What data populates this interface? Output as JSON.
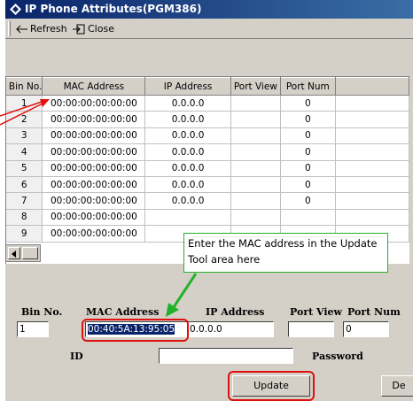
{
  "window": {
    "title": "IP Phone Attributes(PGM386)"
  },
  "toolbar": {
    "refresh_label": "Refresh",
    "close_label": "Close"
  },
  "grid": {
    "columns": [
      "Bin No.",
      "MAC Address",
      "IP Address",
      "Port View",
      "Port Num"
    ],
    "rows": [
      [
        "1",
        "00:00:00:00:00:00",
        "0.0.0.0",
        "",
        "0"
      ],
      [
        "2",
        "00:00:00:00:00:00",
        "0.0.0.0",
        "",
        "0"
      ],
      [
        "3",
        "00:00:00:00:00:00",
        "0.0.0.0",
        "",
        "0"
      ],
      [
        "4",
        "00:00:00:00:00:00",
        "0.0.0.0",
        "",
        "0"
      ],
      [
        "5",
        "00:00:00:00:00:00",
        "0.0.0.0",
        "",
        "0"
      ],
      [
        "6",
        "00:00:00:00:00:00",
        "0.0.0.0",
        "",
        "0"
      ],
      [
        "7",
        "00:00:00:00:00:00",
        "0.0.0.0",
        "",
        "0"
      ],
      [
        "8",
        "00:00:00:00:00:00",
        "",
        "",
        ""
      ],
      [
        "9",
        "00:00:00:00:00:00",
        "",
        "",
        ""
      ]
    ]
  },
  "update": {
    "bin_label": "Bin No.",
    "mac_label": "MAC Address",
    "ip_label": "IP Address",
    "portview_label": "Port View",
    "portnum_label": "Port Num",
    "bin_value": "1",
    "mac_value": "00:40:5A:13:95:05",
    "ip_value": "0.0.0.0",
    "portview_value": "",
    "portnum_value": "0",
    "id_label": "ID",
    "password_label": "Password",
    "id_value": "",
    "update_button": "Update",
    "de_button": "De"
  },
  "annotation": {
    "callout_text": "Enter the MAC address in the Update Tool area here",
    "arrow_color": "#22b22a",
    "highlight_color": "#e01010"
  }
}
